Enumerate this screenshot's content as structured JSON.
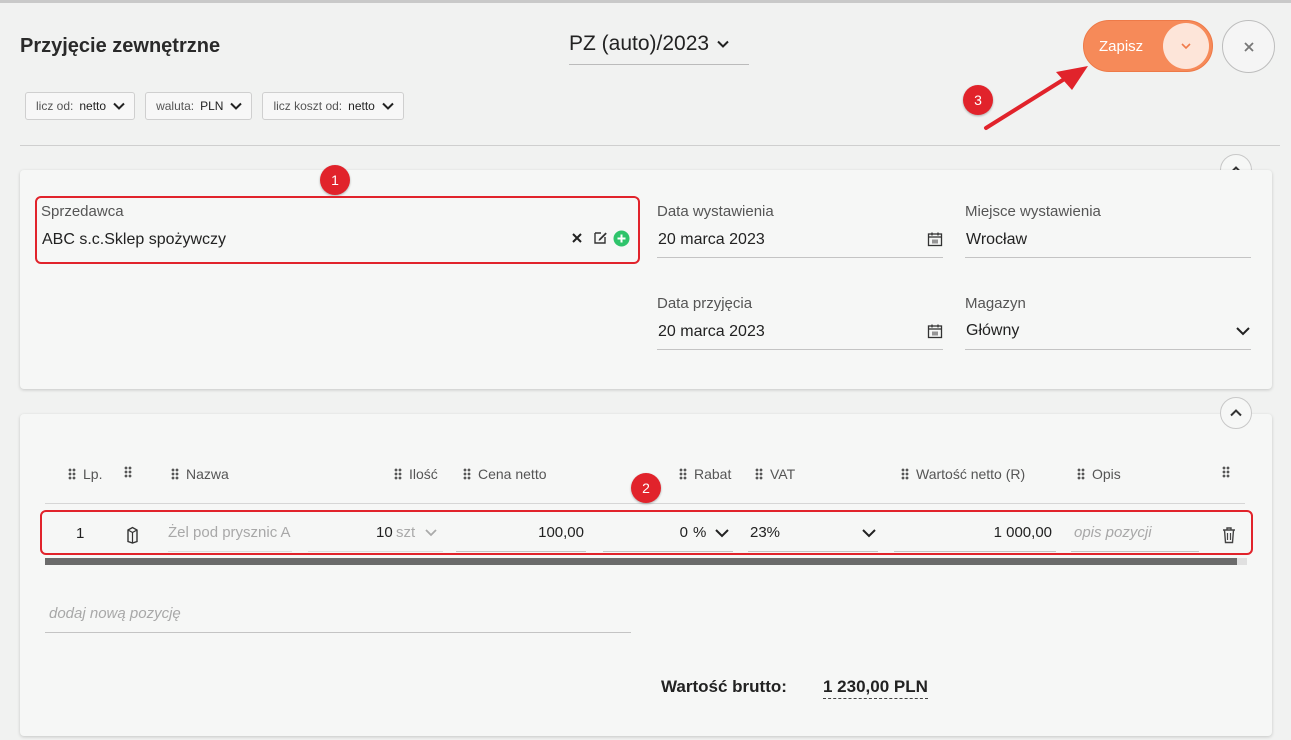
{
  "header": {
    "title": "Przyjęcie zewnętrzne",
    "doc_number": "PZ (auto)/2023",
    "save_label": "Zapisz"
  },
  "filters": [
    {
      "label": "licz od:",
      "value": "netto"
    },
    {
      "label": "waluta:",
      "value": "PLN"
    },
    {
      "label": "licz koszt od:",
      "value": "netto"
    }
  ],
  "annotations": {
    "badge1": "1",
    "badge2": "2",
    "badge3": "3"
  },
  "form": {
    "seller_label": "Sprzedawca",
    "seller_value": "ABC s.c.Sklep spożywczy",
    "issue_date_label": "Data wystawienia",
    "issue_date_value": "20 marca 2023",
    "issue_place_label": "Miejsce wystawienia",
    "issue_place_value": "Wrocław",
    "receipt_date_label": "Data przyjęcia",
    "receipt_date_value": "20 marca 2023",
    "warehouse_label": "Magazyn",
    "warehouse_value": "Główny"
  },
  "table": {
    "columns": {
      "lp": "Lp.",
      "name": "Nazwa",
      "qty": "Ilość",
      "price": "Cena netto",
      "discount": "Rabat",
      "vat": "VAT",
      "net_value": "Wartość netto (R)",
      "desc": "Opis"
    },
    "rows": [
      {
        "lp": "1",
        "name": "Żel pod prysznic A",
        "qty": "10",
        "unit": "szt",
        "price": "100,00",
        "discount": "0",
        "discount_unit": "%",
        "vat": "23%",
        "net_value": "1 000,00",
        "desc_placeholder": "opis pozycji"
      }
    ],
    "add_item_placeholder": "dodaj nową pozycję"
  },
  "totals": {
    "gross_label": "Wartość brutto:",
    "gross_value": "1 230,00 PLN"
  },
  "colors": {
    "accent": "#f68a59",
    "annotation": "#e1232b"
  }
}
